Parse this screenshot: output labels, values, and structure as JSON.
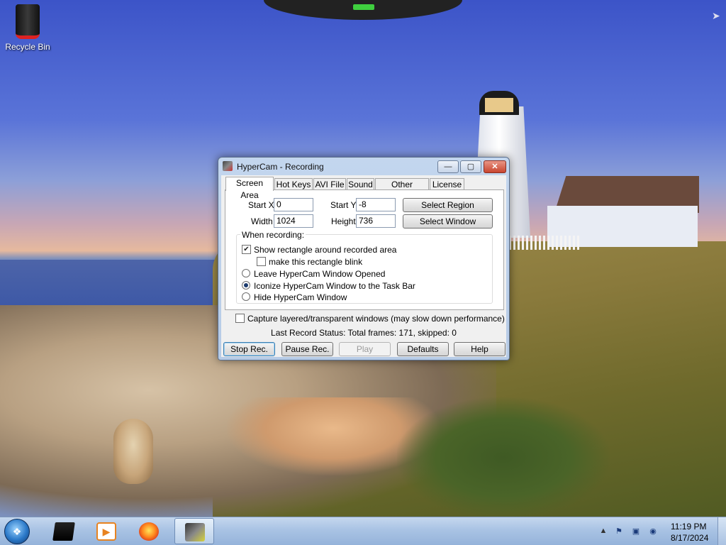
{
  "desktop": {
    "icons": [
      {
        "label": "Recycle Bin"
      }
    ]
  },
  "window": {
    "title": "HyperCam - Recording",
    "controls": {
      "minimize": "—",
      "maximize": "▢",
      "close": "✕"
    },
    "tabs": [
      {
        "label": "Screen Area",
        "active": true
      },
      {
        "label": "Hot Keys"
      },
      {
        "label": "AVI File"
      },
      {
        "label": "Sound"
      },
      {
        "label": "Other Options"
      },
      {
        "label": "License"
      }
    ],
    "screen_area": {
      "start_x_label": "Start X",
      "start_x_value": "0",
      "start_y_label": "Start Y",
      "start_y_value": "-8",
      "width_label": "Width",
      "width_value": "1024",
      "height_label": "Height",
      "height_value": "736",
      "select_region": "Select Region",
      "select_window": "Select Window",
      "when_recording_label": "When recording:",
      "options": {
        "show_rectangle": {
          "label": "Show rectangle around recorded area",
          "checked": true
        },
        "blink_rectangle": {
          "label": "make this rectangle blink",
          "checked": false
        },
        "leave_opened": {
          "label": "Leave HyperCam Window Opened",
          "selected": false
        },
        "iconize": {
          "label": "Iconize HyperCam Window to the Task Bar",
          "selected": true
        },
        "hide_window": {
          "label": "Hide HyperCam Window",
          "selected": false
        }
      },
      "capture_layered": {
        "label": "Capture layered/transparent windows (may slow down performance)",
        "checked": false
      }
    },
    "status": "Last Record Status: Total frames: 171, skipped: 0",
    "buttons": {
      "stop": "Stop Rec.",
      "pause": "Pause Rec.",
      "play": "Play",
      "defaults": "Defaults",
      "help": "Help"
    }
  },
  "taskbar": {
    "tray": {
      "expand": "▲",
      "time": "11:19 PM",
      "date": "8/17/2024"
    }
  }
}
